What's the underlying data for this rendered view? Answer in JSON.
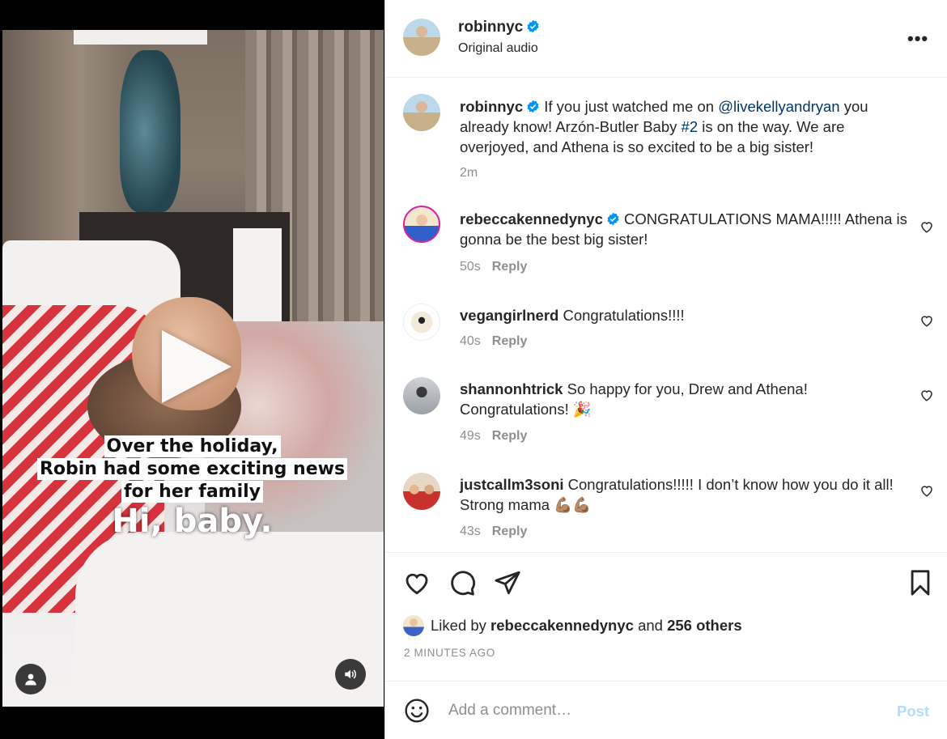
{
  "video": {
    "caption_lines": [
      "Over the holiday,",
      "Robin had some exciting news",
      "for her family"
    ],
    "caption_big": "Hi, baby."
  },
  "header": {
    "username": "robinnyc",
    "subtitle": "Original audio",
    "more": "•••"
  },
  "post": {
    "username": "robinnyc",
    "text_part1": "If you just watched me on ",
    "mention": "@livekellyandryan",
    "text_part2": " you already know! Arzón-Butler Baby ",
    "hashtag": "#2",
    "text_part3": " is on the way. We are overjoyed, and Athena is so excited to be a big sister!",
    "time": "2m"
  },
  "comments": [
    {
      "username": "rebeccakennedynyc",
      "text": "CONGRATULATIONS MAMA!!!!! Athena is gonna be the best big sister!",
      "time": "50s",
      "reply": "Reply"
    },
    {
      "username": "vegangirlnerd",
      "text": "Congratulations!!!!",
      "time": "40s",
      "reply": "Reply"
    },
    {
      "username": "shannonhtrick",
      "text": "So happy for you, Drew and Athena! Congratulations! 🎉",
      "time": "49s",
      "reply": "Reply"
    },
    {
      "username": "justcallm3soni",
      "text": "Congratulations!!!!! I don’t know how you do it all! Strong mama 💪🏽💪🏽",
      "time": "43s",
      "reply": "Reply"
    }
  ],
  "likes": {
    "prefix": "Liked by ",
    "user": "rebeccakennedynyc",
    "middle": " and ",
    "others": "256 others"
  },
  "timestamp": "2 MINUTES AGO",
  "add_comment": {
    "placeholder": "Add a comment…",
    "post_label": "Post"
  },
  "colors": {
    "verified": "#0095f6",
    "link": "#00376b",
    "muted": "#8e8e8e",
    "post_disabled": "#b3dbff"
  },
  "icons": [
    "verified-badge-icon",
    "more-options-icon",
    "heart-icon",
    "comment-icon",
    "share-icon",
    "bookmark-icon",
    "emoji-icon",
    "play-icon",
    "user-tag-icon",
    "sound-icon"
  ]
}
